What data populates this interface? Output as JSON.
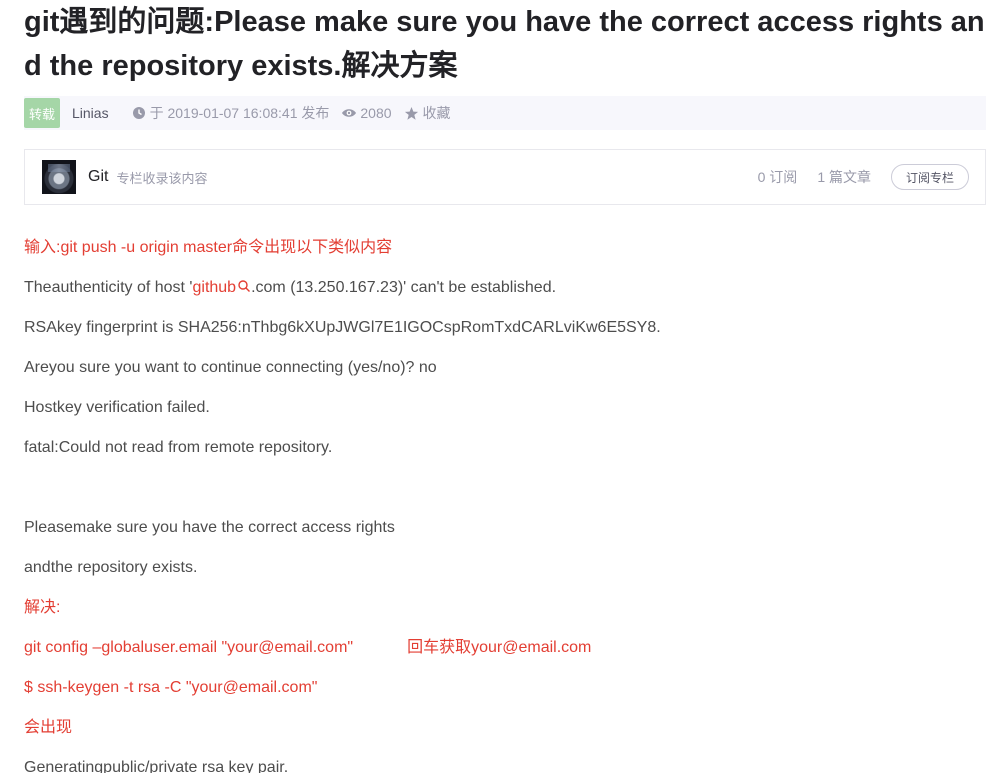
{
  "article": {
    "title": "git遇到的问题:Please make sure you have the correct access rights and the repository exists.解决方案",
    "badge": "转载",
    "author": "Linias",
    "published": "于 2019-01-07 16:08:41 发布",
    "views": "2080",
    "favorite": "收藏"
  },
  "column": {
    "name": "Git",
    "description": "专栏收录该内容",
    "subscriptions": "0 订阅",
    "articles": "1 篇文章",
    "subscribe_label": "订阅专栏"
  },
  "content": {
    "line1": "输入:git push -u origin master命令出现以下类似内容",
    "line2_pre": "Theauthenticity of host '",
    "line2_link": "github",
    "line2_post": ".com (13.250.167.23)' can't be established.",
    "line3": "RSAkey fingerprint is SHA256:nThbg6kXUpJWGl7E1IGOCspRomTxdCARLviKw6E5SY8.",
    "line4": "Areyou sure you want to continue connecting (yes/no)? no",
    "line5": "Hostkey verification failed.",
    "line6": "fatal:Could not read from remote repository.",
    "line7": "Pleasemake sure you have the correct access rights",
    "line8": "andthe repository exists.",
    "line9": "解决:",
    "line10a": "git config –globaluser.email \"your@email.com\"",
    "line10b": "回车获取your@email.com",
    "line11": "$ ssh-keygen -t rsa -C \"your@email.com\"",
    "line12": "会出现",
    "line13": "Generatingpublic/private rsa key pair."
  },
  "colors": {
    "red_text": "#e33e33",
    "badge_bg": "#a5d6a7",
    "meta_bg": "#f7f7fc"
  }
}
